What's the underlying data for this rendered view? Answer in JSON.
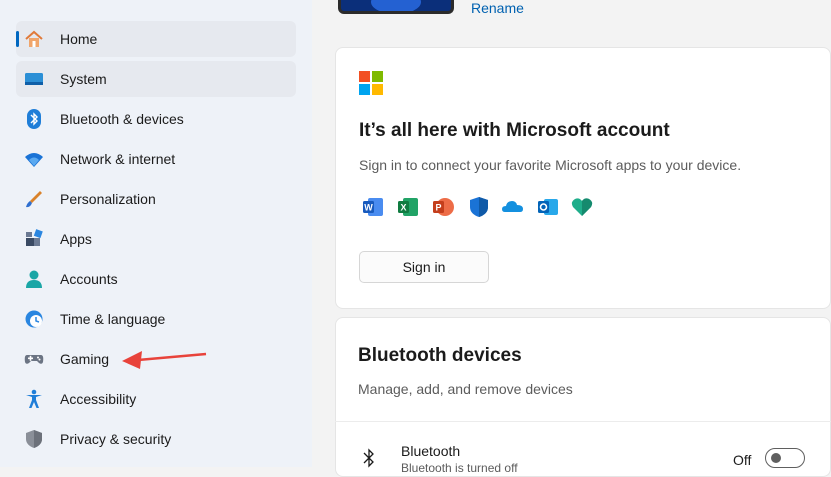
{
  "sidebar": {
    "items": [
      {
        "label": "Home",
        "icon": "home-icon"
      },
      {
        "label": "System",
        "icon": "monitor-icon"
      },
      {
        "label": "Bluetooth & devices",
        "icon": "bluetooth-icon"
      },
      {
        "label": "Network & internet",
        "icon": "wifi-icon"
      },
      {
        "label": "Personalization",
        "icon": "paintbrush-icon"
      },
      {
        "label": "Apps",
        "icon": "apps-icon"
      },
      {
        "label": "Accounts",
        "icon": "person-icon"
      },
      {
        "label": "Time & language",
        "icon": "clock-globe-icon"
      },
      {
        "label": "Gaming",
        "icon": "gamepad-icon"
      },
      {
        "label": "Accessibility",
        "icon": "accessibility-icon"
      },
      {
        "label": "Privacy & security",
        "icon": "shield-icon"
      }
    ]
  },
  "header": {
    "rename_label": "Rename"
  },
  "microsoft_card": {
    "title": "It’s all here with Microsoft account",
    "subtitle": "Sign in to connect your favorite Microsoft apps to your device.",
    "sign_in_label": "Sign in",
    "apps": [
      "word-icon",
      "excel-icon",
      "powerpoint-icon",
      "defender-icon",
      "onedrive-icon",
      "outlook-icon",
      "family-icon"
    ]
  },
  "bluetooth_card": {
    "title": "Bluetooth devices",
    "subtitle": "Manage, add, and remove devices",
    "row_label": "Bluetooth",
    "row_sub": "Bluetooth is turned off",
    "toggle_state": "Off"
  },
  "colors": {
    "accent": "#0067c0",
    "annotation_arrow": "#e8433b"
  }
}
